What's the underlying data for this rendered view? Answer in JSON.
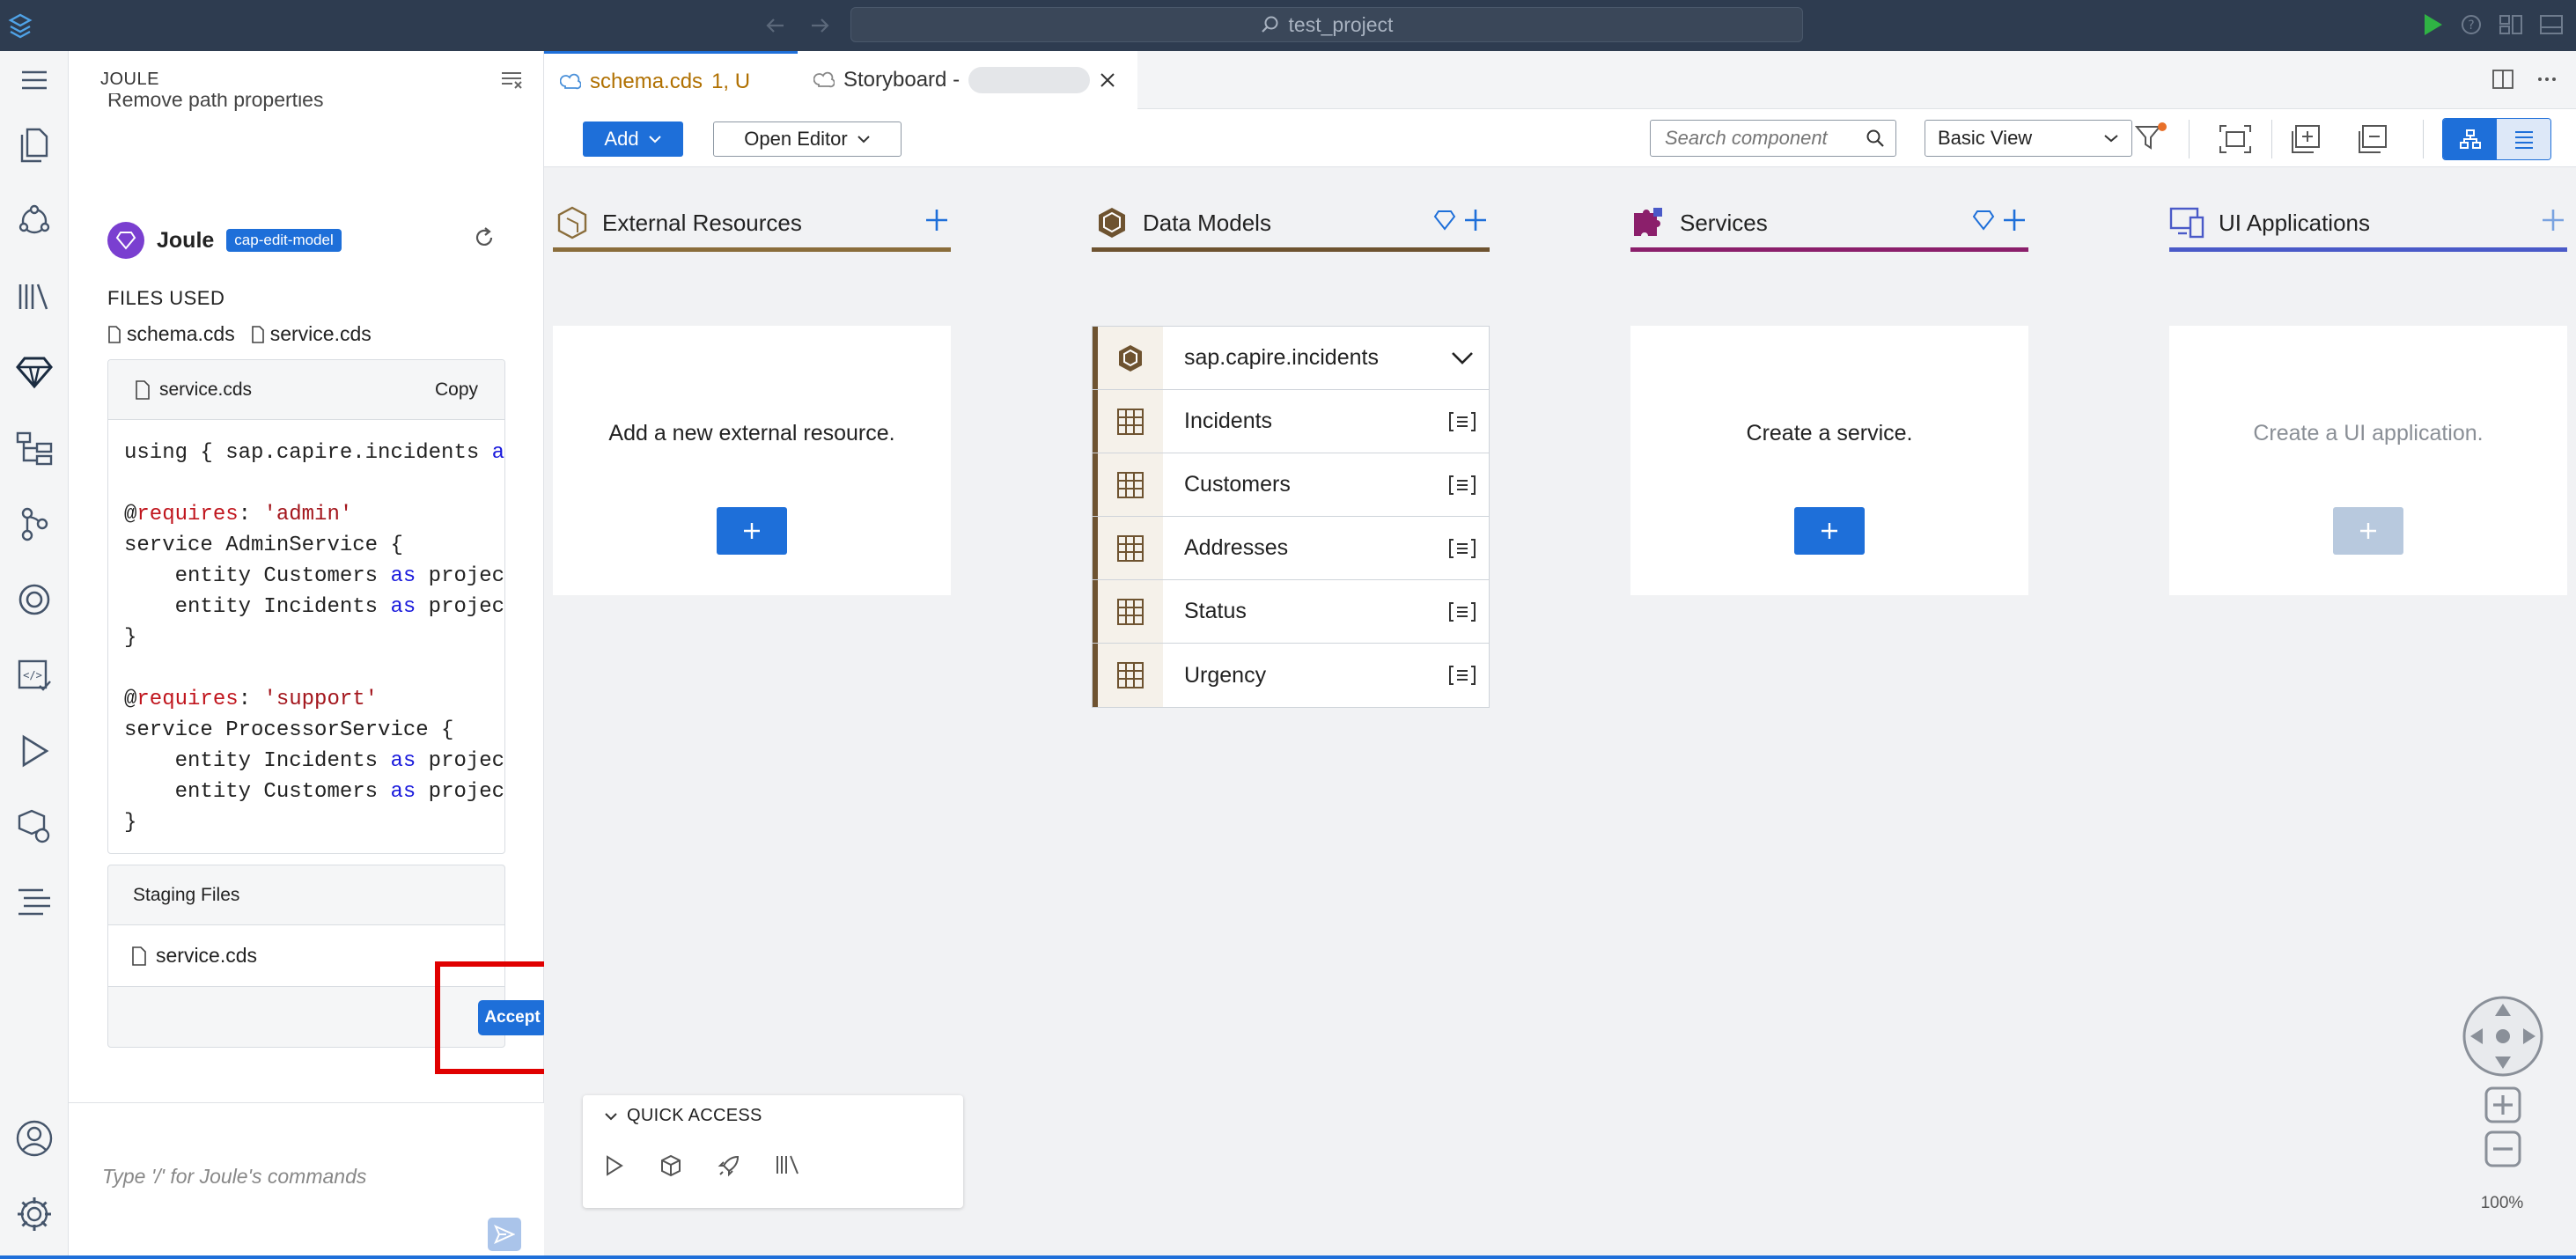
{
  "titlebar": {
    "command_center": "test_project"
  },
  "joule": {
    "panel_title": "JOULE",
    "truncated_text": "Remove path properties",
    "assistant_name": "Joule",
    "mode_badge": "cap-edit-model",
    "files_used_label": "FILES USED",
    "files_used": [
      "schema.cds",
      "service.cds"
    ],
    "code_card": {
      "filename": "service.cds",
      "copy_label": "Copy",
      "lines": {
        "l1_a": "using { sap.capire.incidents ",
        "l1_b": "as",
        "l3_dec": "@",
        "l3_req": "requires",
        "l3_colon": ": ",
        "l3_str": "'admin'",
        "l4": "service AdminService {",
        "l5_a": "    entity Customers ",
        "l5_kw": "as",
        "l5_b": " project",
        "l6_a": "    entity Incidents ",
        "l6_kw": "as",
        "l6_b": " project",
        "l7": "}",
        "l9_dec": "@",
        "l9_req": "requires",
        "l9_colon": ": ",
        "l9_str": "'support'",
        "l10": "service ProcessorService {",
        "l11_a": "    entity Incidents ",
        "l11_kw": "as",
        "l11_b": " project",
        "l12_a": "    entity Customers ",
        "l12_kw": "as",
        "l12_b": " project",
        "l13": "}"
      }
    },
    "staging": {
      "title": "Staging Files",
      "file": "service.cds",
      "accept_label": "Accept"
    },
    "input_placeholder": "Type '/' for Joule's commands"
  },
  "tabs": [
    {
      "label": "schema.cds",
      "modifier": "1, U",
      "active": true
    },
    {
      "label": "Storyboard -",
      "active": false
    }
  ],
  "toolbar": {
    "add_label": "Add",
    "open_editor_label": "Open Editor",
    "search_placeholder": "Search component",
    "view_select": "Basic View"
  },
  "columns": {
    "external": {
      "title": "External Resources",
      "empty_msg": "Add a new external resource.",
      "accent": "#8a6d3b"
    },
    "data_models": {
      "title": "Data Models",
      "accent": "#6e5330"
    },
    "services": {
      "title": "Services",
      "empty_msg": "Create a service.",
      "accent": "#8b1f6b"
    },
    "ui_apps": {
      "title": "UI Applications",
      "empty_msg": "Create a UI application.",
      "accent": "#4a5ac8"
    }
  },
  "data_models": {
    "namespace": "sap.capire.incidents",
    "entities": [
      "Incidents",
      "Customers",
      "Addresses",
      "Status",
      "Urgency"
    ]
  },
  "quick_access": {
    "title": "QUICK ACCESS"
  },
  "zoom": {
    "level": "100%"
  }
}
